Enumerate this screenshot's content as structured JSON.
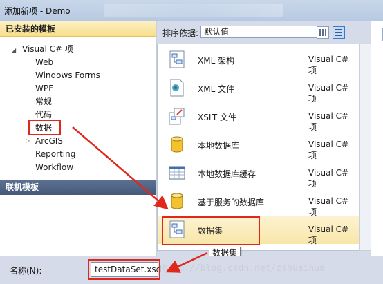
{
  "window": {
    "title": "添加新项 - Demo"
  },
  "left_panel": {
    "installed_header": "已安装的模板",
    "root": "Visual C# 项",
    "items": [
      "Web",
      "Windows Forms",
      "WPF",
      "常规",
      "代码",
      "数据",
      "ArcGIS",
      "Reporting",
      "Workflow"
    ],
    "online_header": "联机模板"
  },
  "toolbar": {
    "sort_label": "排序依据:",
    "sort_value": "默认值"
  },
  "templates": [
    {
      "name": "XML 架构",
      "lang": "Visual C# 项",
      "icon": "xml-schema-icon"
    },
    {
      "name": "XML 文件",
      "lang": "Visual C# 项",
      "icon": "xml-file-icon"
    },
    {
      "name": "XSLT 文件",
      "lang": "Visual C# 项",
      "icon": "xslt-file-icon"
    },
    {
      "name": "本地数据库",
      "lang": "Visual C# 项",
      "icon": "database-icon"
    },
    {
      "name": "本地数据库缓存",
      "lang": "Visual C# 项",
      "icon": "database-cache-icon"
    },
    {
      "name": "基于服务的数据库",
      "lang": "Visual C# 项",
      "icon": "service-database-icon"
    },
    {
      "name": "数据集",
      "lang": "Visual C# 项",
      "icon": "dataset-icon"
    }
  ],
  "tooltip": "数据集",
  "bottom": {
    "name_label": "名称(N):",
    "name_value": "testDataSet.xsd"
  },
  "watermark": "http://blog.csdn.net/zshuaihua",
  "colors": {
    "annotation": "#e1261c",
    "selection": "#f8e6a8",
    "online_header": "#46597a"
  }
}
